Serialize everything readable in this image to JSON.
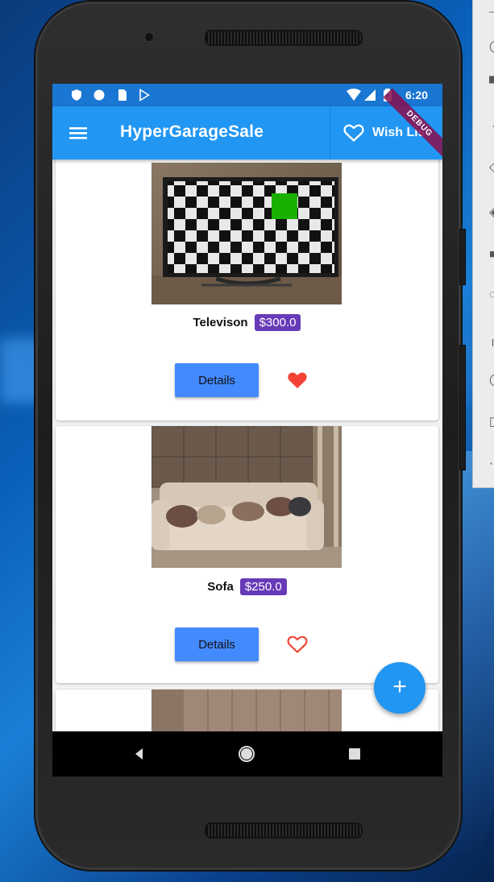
{
  "status_bar": {
    "time": "6:20",
    "debug_label": "DEBUG"
  },
  "app_bar": {
    "title": "HyperGarageSale",
    "wish_list_label": "Wish List",
    "menu_icon": "menu-icon",
    "wish_icon": "heart-outline-icon"
  },
  "items": [
    {
      "name": "Televison",
      "price": "$300.0",
      "details_label": "Details",
      "favorited": true,
      "image_icon": "television-photo"
    },
    {
      "name": "Sofa",
      "price": "$250.0",
      "details_label": "Details",
      "favorited": false,
      "image_icon": "sofa-photo"
    }
  ],
  "fab": {
    "label": "+"
  },
  "colors": {
    "app_bar": "#2196f3",
    "status_bar": "#1976d2",
    "price_badge": "#673ab7",
    "details_button": "#448aff",
    "favorite": "#f44336"
  }
}
